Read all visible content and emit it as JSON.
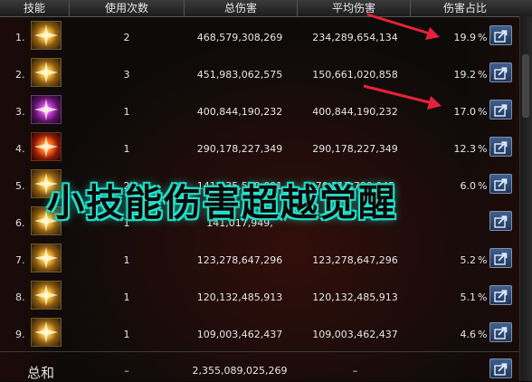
{
  "header": {
    "skill": "技能",
    "uses": "使用次数",
    "total_damage": "总伤害",
    "avg_damage": "平均伤害",
    "damage_share": "伤害占比"
  },
  "rows": [
    {
      "rank": "1.",
      "uses": "2",
      "total": "468,579,308,269",
      "avg": "234,289,654,134",
      "pct": "19.9",
      "unit": "%"
    },
    {
      "rank": "2.",
      "uses": "3",
      "total": "451,983,062,575",
      "avg": "150,661,020,858",
      "pct": "19.2",
      "unit": "%"
    },
    {
      "rank": "3.",
      "uses": "1",
      "total": "400,844,190,232",
      "avg": "400,844,190,232",
      "pct": "17.0",
      "unit": "%"
    },
    {
      "rank": "4.",
      "uses": "1",
      "total": "290,178,227,349",
      "avg": "290,178,227,349",
      "pct": "12.3",
      "unit": "%"
    },
    {
      "rank": "5.",
      "uses": "2",
      "total": "141,035,560,091",
      "avg": "70,517,780,045",
      "pct": "6.0",
      "unit": "%"
    },
    {
      "rank": "6.",
      "uses": "1",
      "total": "141,017,949,",
      "avg": "",
      "pct": "",
      "unit": ""
    },
    {
      "rank": "7.",
      "uses": "1",
      "total": "123,278,647,296",
      "avg": "123,278,647,296",
      "pct": "5.2",
      "unit": "%"
    },
    {
      "rank": "8.",
      "uses": "1",
      "total": "120,132,485,913",
      "avg": "120,132,485,913",
      "pct": "5.1",
      "unit": "%"
    },
    {
      "rank": "9.",
      "uses": "1",
      "total": "109,003,462,437",
      "avg": "109,003,462,437",
      "pct": "4.6",
      "unit": "%"
    }
  ],
  "summary": {
    "label": "总和",
    "uses": "–",
    "total": "2,355,089,025,269",
    "avg": "–"
  },
  "overlay_text": "小技能伤害超越觉醒",
  "colors": {
    "overlay_glow": "#1ad7c0",
    "arrow": "#e8213a",
    "share_button": "#2f4f7e"
  },
  "icons": {
    "share": "share-export-icon"
  }
}
